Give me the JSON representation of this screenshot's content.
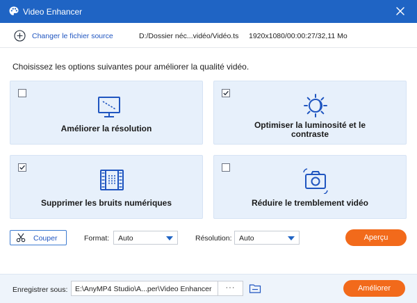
{
  "window": {
    "title": "Video Enhancer"
  },
  "source": {
    "change_label": "Changer le fichier source",
    "path": "D:/Dossier néc...vidéo/Vidéo.ts",
    "info": "1920x1080/00:00:27/32,11 Mo"
  },
  "prompt": "Choisissez les options suivantes pour améliorer la qualité vidéo.",
  "options": [
    {
      "label_1": "Améliorer la résolution",
      "label_2": "",
      "checked": false,
      "icon": "upscale-monitor-icon"
    },
    {
      "label_1": "Optimiser la luminosité et le",
      "label_2": "contraste",
      "checked": true,
      "icon": "brightness-icon"
    },
    {
      "label_1": "Supprimer les bruits numériques",
      "label_2": "",
      "checked": true,
      "icon": "film-denoise-icon"
    },
    {
      "label_1": "Réduire le tremblement vidéo",
      "label_2": "",
      "checked": false,
      "icon": "shaking-camera-icon"
    }
  ],
  "controls": {
    "cut_label": "Couper",
    "format_label": "Format:",
    "format_value": "Auto",
    "resolution_label": "Résolution:",
    "resolution_value": "Auto",
    "preview_label": "Aperçu"
  },
  "footer": {
    "save_label": "Enregistrer sous:",
    "save_path": "E:\\AnyMP4 Studio\\A...per\\Video Enhancer",
    "browse_label": "···",
    "enhance_label": "Améliorer"
  },
  "colors": {
    "title_bar": "#1f64c4",
    "accent_orange": "#f26a1b",
    "card_bg": "#e7f0fb",
    "icon_blue": "#1f55c0"
  }
}
